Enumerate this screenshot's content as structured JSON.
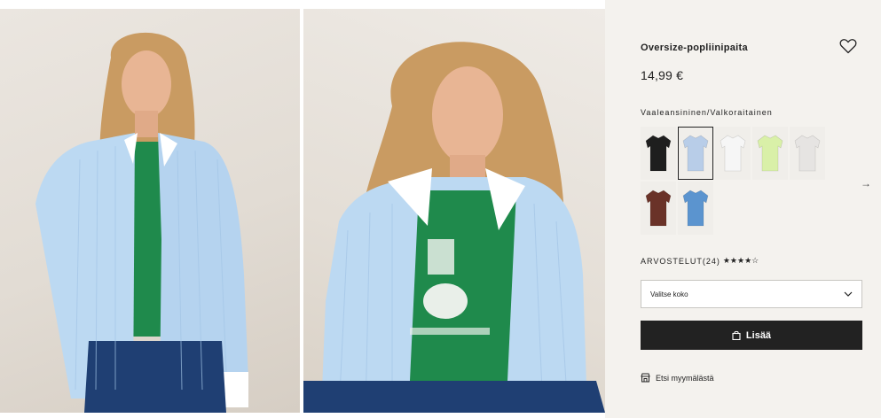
{
  "product": {
    "name": "Oversize-popliinipaita",
    "price": "14,99 €",
    "color_label": "Vaaleansininen/Valkoraitainen"
  },
  "colors": {
    "accent": "#222222",
    "panel_bg": "#f4f2ee",
    "shirt_blue": "#bcd9f2",
    "tee_green": "#1f8a4c"
  },
  "swatches": [
    {
      "name": "black",
      "color": "#1e1e1e",
      "selected": false
    },
    {
      "name": "light-blue-check",
      "color": "#b8cde8",
      "selected": true
    },
    {
      "name": "white",
      "color": "#f6f6f6",
      "selected": false
    },
    {
      "name": "lime",
      "color": "#d9f0a8",
      "selected": false
    },
    {
      "name": "light-grey",
      "color": "#e6e4e2",
      "selected": false
    },
    {
      "name": "brown",
      "color": "#6a3228",
      "selected": false
    },
    {
      "name": "blue",
      "color": "#5b94cf",
      "selected": false
    }
  ],
  "reviews": {
    "label": "ARVOSTELUT(24)",
    "stars": "★★★★☆",
    "rating": 3.5,
    "max": 5
  },
  "size_select": {
    "placeholder": "Valitse koko"
  },
  "add_button": {
    "label": "Lisää"
  },
  "store_link": {
    "label": "Etsi myymälästä"
  }
}
